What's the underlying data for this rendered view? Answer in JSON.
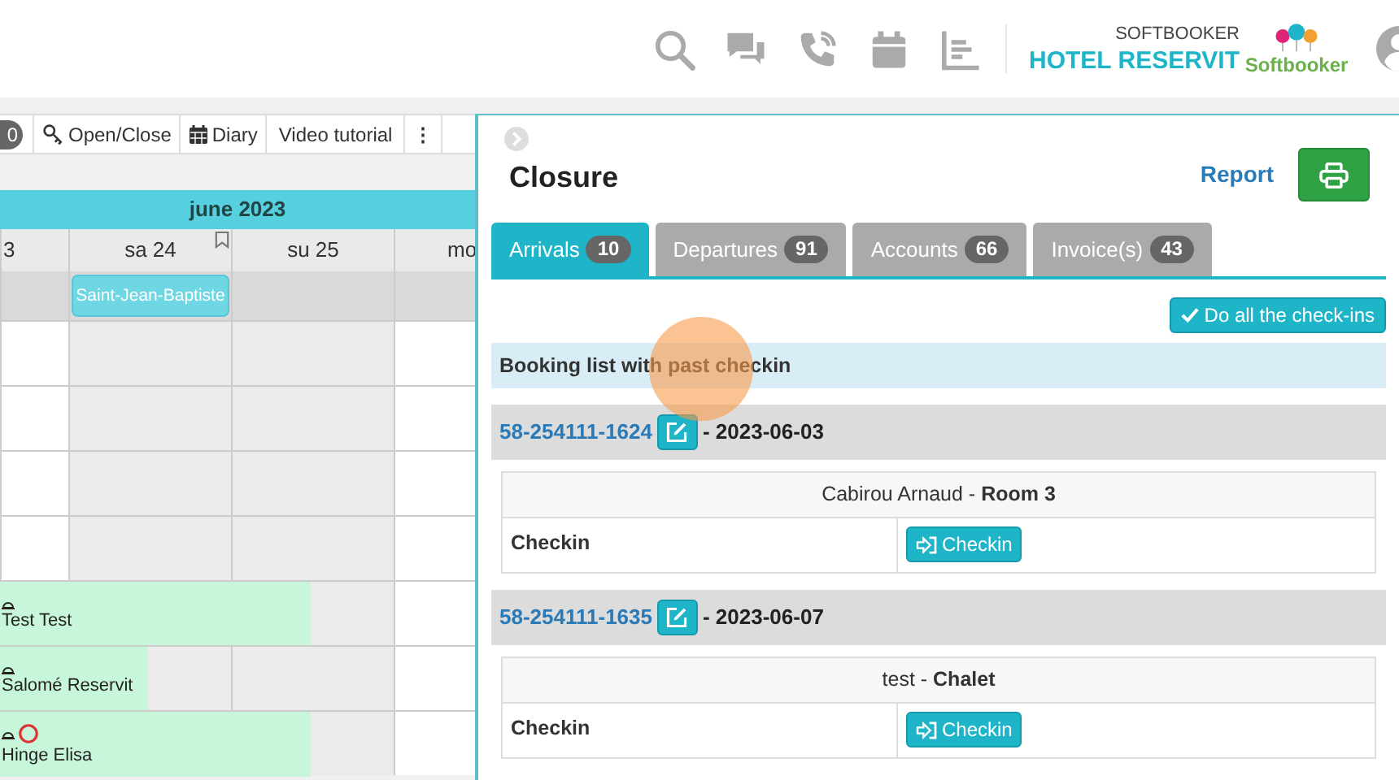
{
  "header": {
    "brand_top": "SOFTBOOKER",
    "brand_name": "HOTEL RESERVIT",
    "logo_text": "Softbooker"
  },
  "calendar": {
    "toolbar": [
      {
        "kind": "badge",
        "label": "0"
      },
      {
        "kind": "key",
        "label": "Open/Close"
      },
      {
        "kind": "diary",
        "label": "Diary"
      },
      {
        "kind": "plain",
        "label": "Video tutorial"
      },
      {
        "kind": "more",
        "label": "⋮"
      }
    ],
    "month": "june 2023",
    "days": [
      {
        "label": "3",
        "weekend": false
      },
      {
        "label": "sa 24",
        "weekend": true
      },
      {
        "label": "su 25",
        "weekend": true
      },
      {
        "label": "mo",
        "weekend": false
      }
    ],
    "holiday": {
      "label": "Saint-Jean-Baptiste"
    },
    "rows": [
      {},
      {},
      {},
      {},
      {
        "guest": "Test Test",
        "alert": false
      },
      {
        "guest": "Salomé Reservit",
        "alert": false
      },
      {
        "guest": "Hinge Elisa",
        "alert": true
      }
    ]
  },
  "panel": {
    "title": "Closure",
    "report": "Report",
    "tabs": [
      {
        "label": "Arrivals",
        "count": "10",
        "selected": true
      },
      {
        "label": "Departures",
        "count": "91",
        "selected": false
      },
      {
        "label": "Accounts",
        "count": "66",
        "selected": false
      },
      {
        "label": "Invoice(s)",
        "count": "43",
        "selected": false
      }
    ],
    "do_all": "Do all the check-ins",
    "notice": "Booking list with past checkin",
    "bookings": [
      {
        "ref": "58-254111-1624",
        "date": "- 2023-06-03",
        "guest": "Cabirou Arnaud - **Room 3**",
        "row_label": "Checkin",
        "action": "Checkin"
      },
      {
        "ref": "58-254111-1635",
        "date": "- 2023-06-07",
        "guest": "test - **Chalet**",
        "row_label": "Checkin",
        "action": "Checkin"
      }
    ]
  }
}
